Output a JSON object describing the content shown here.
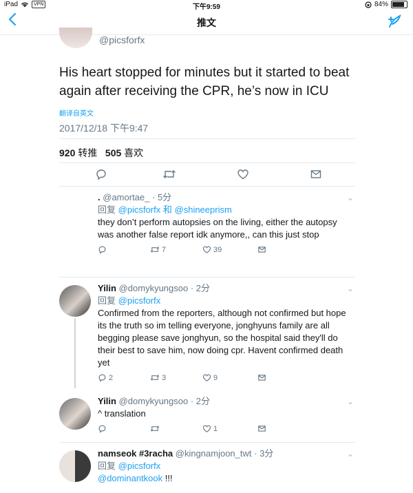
{
  "status": {
    "device": "iPad",
    "vpn": "VPN",
    "time": "下午9:59",
    "battery": "84%"
  },
  "nav": {
    "title": "推文"
  },
  "tweet": {
    "handle": "@picsforfx",
    "text": "His heart stopped for minutes but it started to beat again after receiving the CPR, he’s now in ICU",
    "translate_link": "翻译自英文",
    "date": "2017/12/18 下午9:47",
    "retweets_count": "920",
    "retweets_label": "转推",
    "likes_count": "505",
    "likes_label": "喜欢"
  },
  "replies": [
    {
      "name": ".",
      "handle": "@amortae_",
      "time": "· 5分",
      "reply_prefix": "回复",
      "reply_to_1": "@picsforfx",
      "reply_and": "和",
      "reply_to_2": "@shineeprism",
      "text": "they don’t perform autopsies on the living, either the autopsy was another false report idk anymore,, can this just stop",
      "reply_count": "",
      "retweet_count": "7",
      "like_count": "39"
    },
    {
      "name": "Yilin",
      "handle": "@domykyungsoo",
      "time": "· 2分",
      "reply_prefix": "回复",
      "reply_to_1": "@picsforfx",
      "text": "Confirmed from the reporters, although not confirmed but hope its the truth so im telling everyone, jonghyuns family are all begging please save jonghyun, so the hospital said they'll do their best to save him, now doing cpr. Havent confirmed death yet",
      "reply_count": "2",
      "retweet_count": "3",
      "like_count": "9"
    },
    {
      "name": "Yilin",
      "handle": "@domykyungsoo",
      "time": "· 2分",
      "text": "^ translation",
      "reply_count": "",
      "retweet_count": "",
      "like_count": "1"
    },
    {
      "name": "namseok #3racha",
      "handle": "@kingnamjoon_twt",
      "time": "· 3分",
      "reply_prefix": "回复",
      "reply_to_1": "@picsforfx",
      "mention": "@dominantkook",
      "text_tail": " !!!"
    }
  ],
  "colors": {
    "accent": "#1da1f2",
    "muted": "#657786",
    "text": "#14171a",
    "divider": "#e1e8ed"
  }
}
